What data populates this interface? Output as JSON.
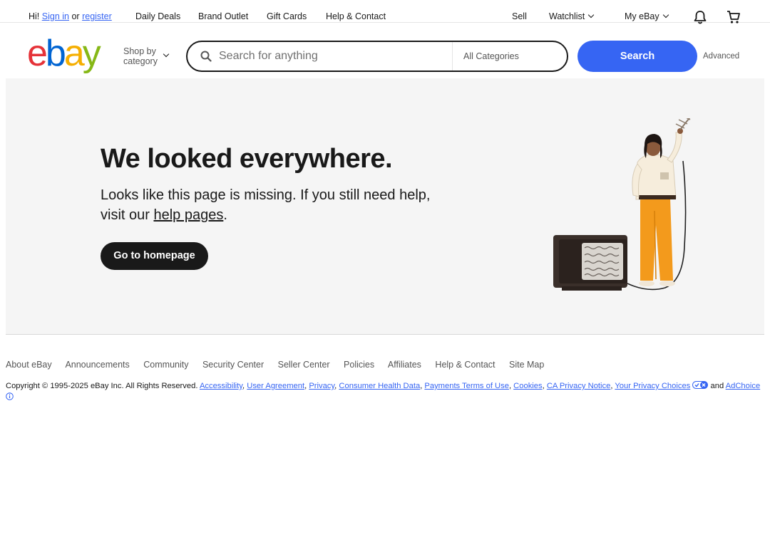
{
  "topbar": {
    "greeting": "Hi!",
    "sign_in": "Sign in",
    "or": "or",
    "register": "register",
    "nav": [
      "Daily Deals",
      "Brand Outlet",
      "Gift Cards",
      "Help & Contact"
    ],
    "sell": "Sell",
    "watchlist": "Watchlist",
    "myebay": "My eBay"
  },
  "header": {
    "logo": {
      "e": "e",
      "b": "b",
      "a": "a",
      "y": "y"
    },
    "shop_by_1": "Shop by",
    "shop_by_2": "category",
    "search_placeholder": "Search for anything",
    "category": "All Categories",
    "search_button": "Search",
    "advanced": "Advanced"
  },
  "main": {
    "heading": "We looked everywhere.",
    "sub_1": "Looks like this page is missing. If you still need help,",
    "sub_2": "visit our",
    "sub_link": "help pages",
    "sub_end": ".",
    "home_button": "Go to homepage"
  },
  "footer": {
    "links": [
      "About eBay",
      "Announcements",
      "Community",
      "Security Center",
      "Seller Center",
      "Policies",
      "Affiliates",
      "Help & Contact",
      "Site Map"
    ],
    "copyright": "Copyright © 1995-2025 eBay Inc. All Rights Reserved.",
    "legal": [
      "Accessibility",
      "User Agreement",
      "Privacy",
      "Consumer Health Data",
      "Payments Terms of Use",
      "Cookies",
      "CA Privacy Notice",
      "Your Privacy Choices"
    ],
    "and": "and",
    "adchoice": "AdChoice"
  },
  "colors": {
    "brand_blue": "#3665f3",
    "logo_red": "#e53238",
    "logo_blue": "#0064d2",
    "logo_yellow": "#f5af02",
    "logo_green": "#86b817",
    "panel_bg": "#f5f5f5"
  }
}
